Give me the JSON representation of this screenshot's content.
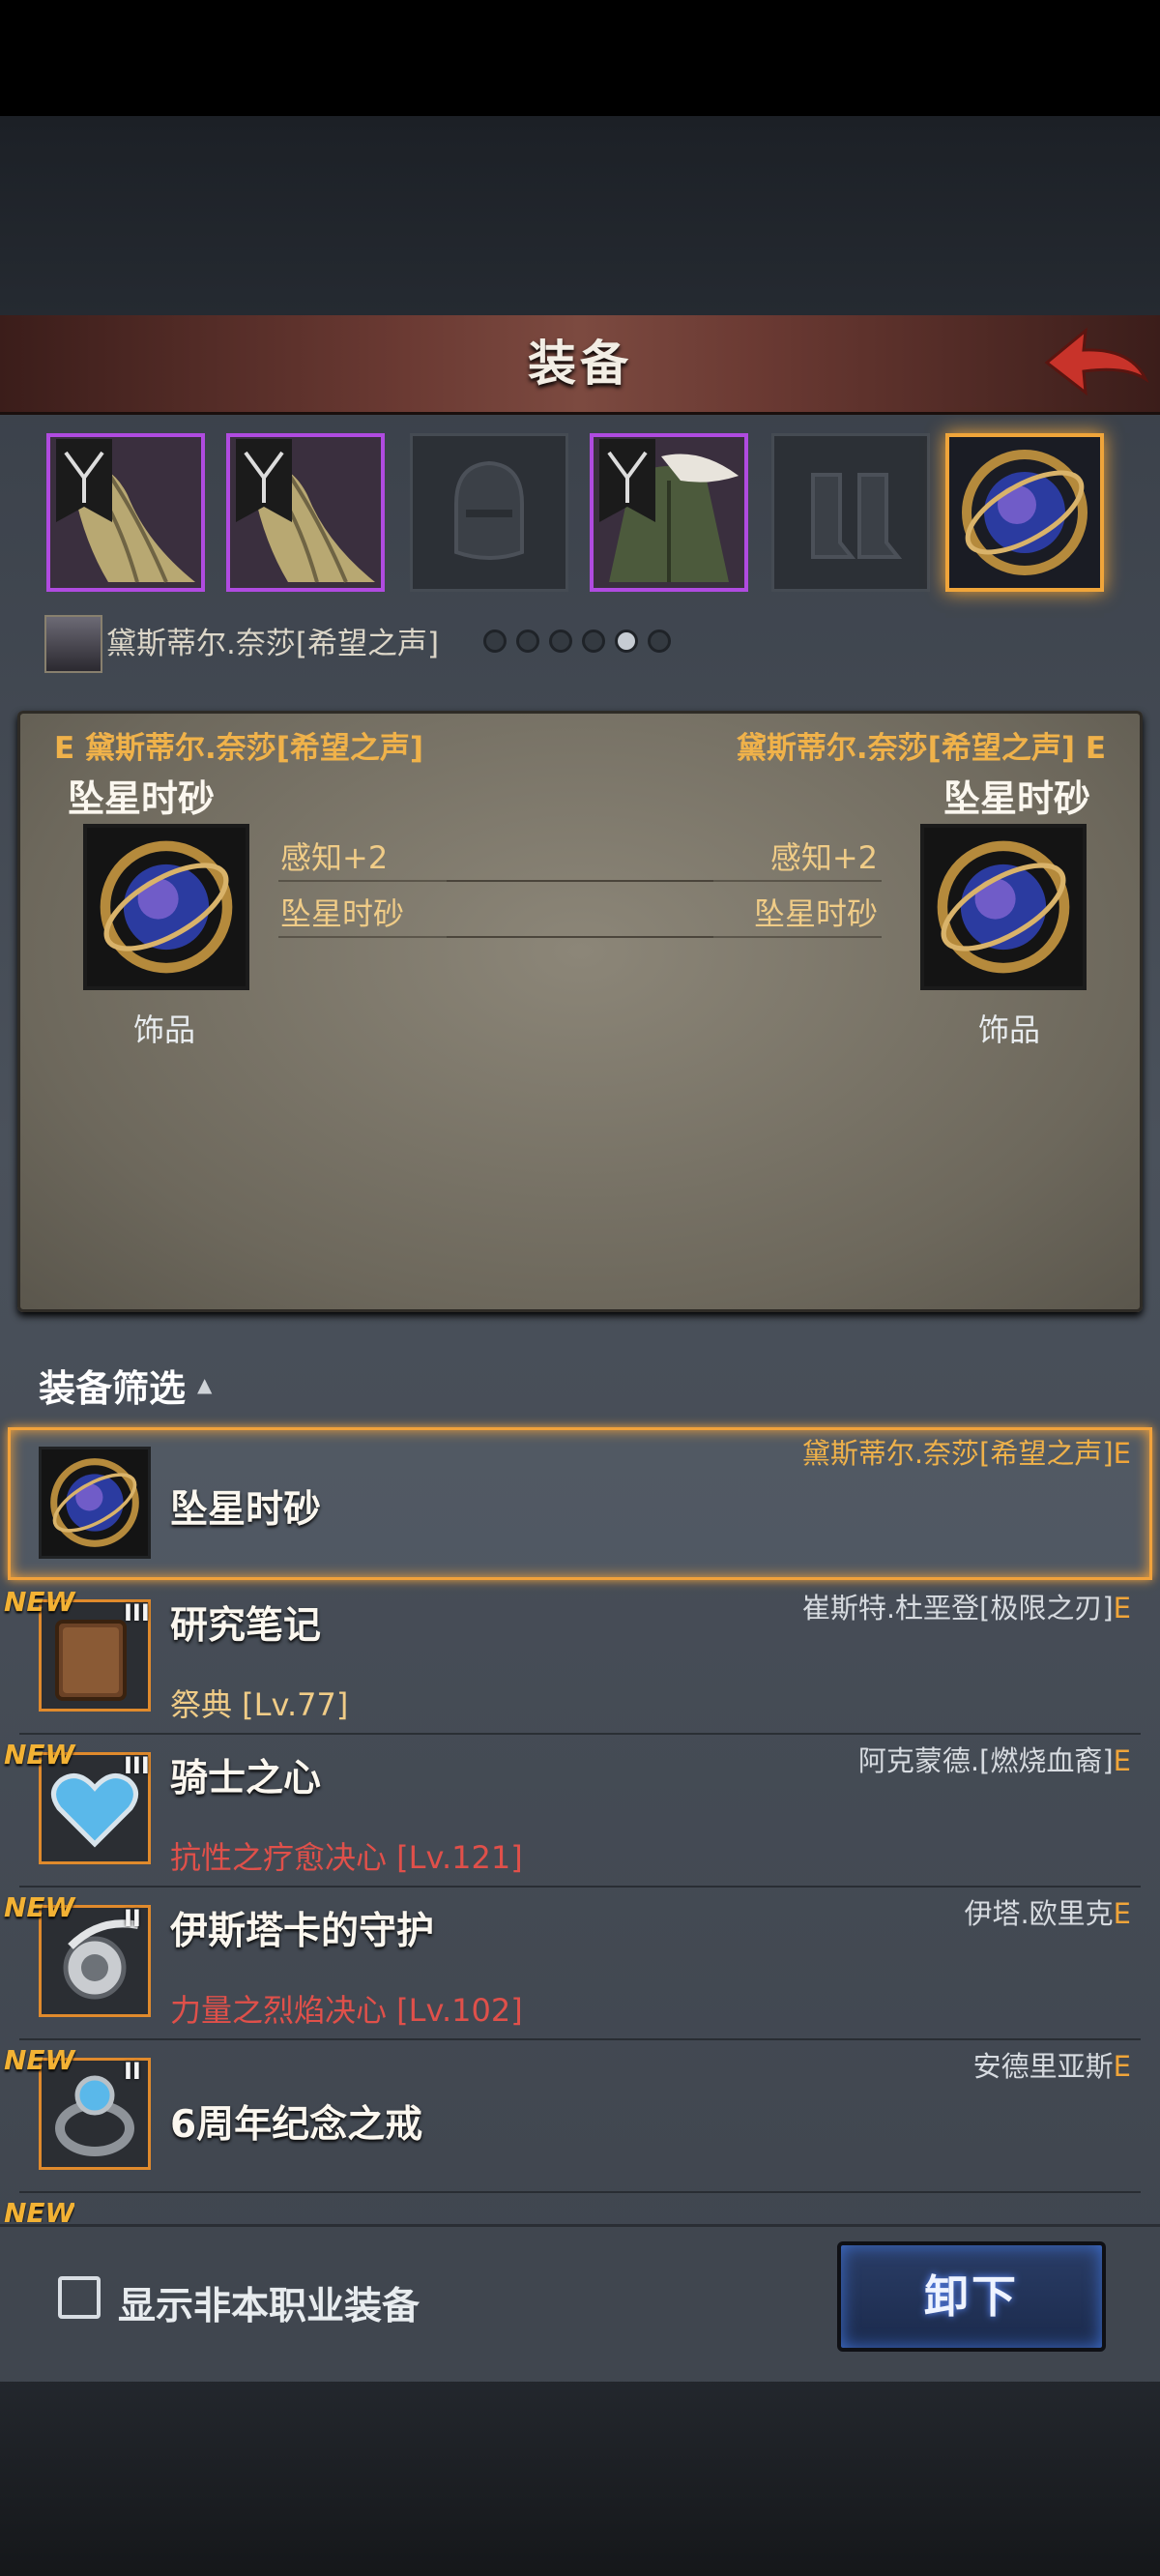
{
  "header": {
    "title": "装备"
  },
  "character": {
    "name": "黛斯蒂尔.奈莎[希望之声]"
  },
  "slots": [
    {
      "type": "cloak",
      "state": "purple"
    },
    {
      "type": "cloak",
      "state": "purple"
    },
    {
      "type": "helmet",
      "state": "empty"
    },
    {
      "type": "coat",
      "state": "purple"
    },
    {
      "type": "boots",
      "state": "empty"
    },
    {
      "type": "accessory",
      "state": "selected"
    }
  ],
  "page_dots": {
    "total": 6,
    "active": 5
  },
  "compare": {
    "left": {
      "grade": "E",
      "owner": "黛斯蒂尔.奈莎[希望之声]",
      "item": "坠星时砂",
      "stat": "感知+2",
      "effect": "坠星时砂",
      "category": "饰品"
    },
    "right": {
      "grade": "E",
      "owner": "黛斯蒂尔.奈莎[希望之声]",
      "item": "坠星时砂",
      "stat": "感知+2",
      "effect": "坠星时砂",
      "category": "饰品"
    }
  },
  "filter": {
    "label": "装备筛选"
  },
  "list": {
    "items": [
      {
        "name": "坠星时砂",
        "owner": "黛斯蒂尔.奈莎[希望之声]",
        "grade": "E",
        "selected": true
      },
      {
        "name": "研究笔记",
        "new": "NEW",
        "tier": "III",
        "sub": "祭典 [Lv.77]",
        "owner": "崔斯特.杜垩登[极限之刃]",
        "grade": "E"
      },
      {
        "name": "骑士之心",
        "new": "NEW",
        "tier": "III",
        "sub": "抗性之疗愈决心 [Lv.121]",
        "owner": "阿克蒙德.[燃烧血裔]",
        "grade": "E"
      },
      {
        "name": "伊斯塔卡的守护",
        "new": "NEW",
        "tier": "II",
        "sub": "力量之烈焰决心 [Lv.102]",
        "owner": "伊塔.欧里克",
        "grade": "E"
      },
      {
        "name": "6周年纪念之戒",
        "new": "NEW",
        "tier": "II",
        "owner": "安德里亚斯",
        "grade": "E"
      },
      {
        "new": "NEW"
      }
    ]
  },
  "bottom": {
    "checkbox_label": "显示非本职业装备",
    "unequip": "卸下"
  },
  "colors": {
    "gold": "#f0a53a",
    "purple": "#b04be0",
    "sub_red": "#e0504a",
    "sub_tan": "#f0cc87"
  }
}
